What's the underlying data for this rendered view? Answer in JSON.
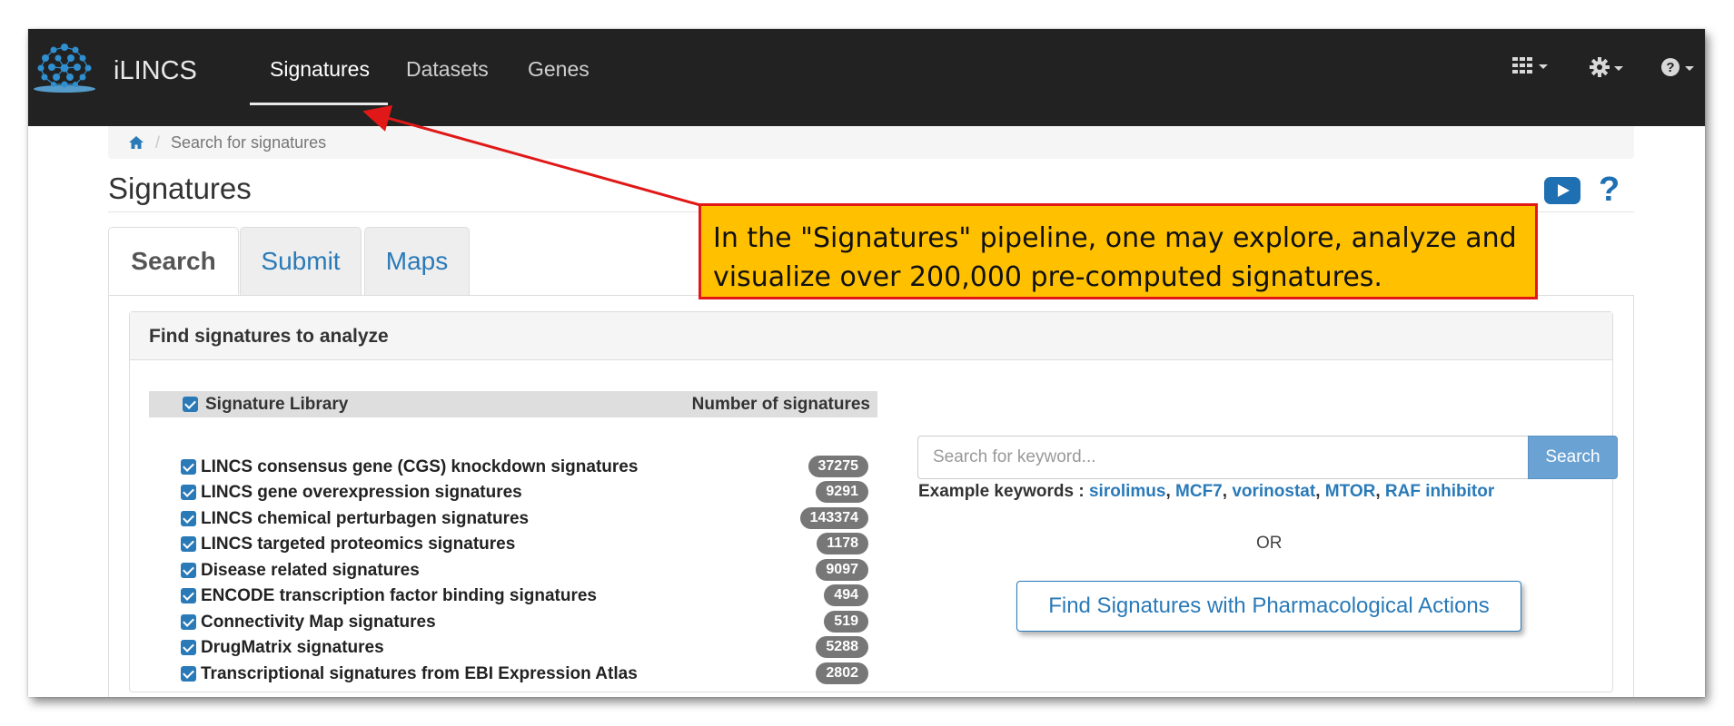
{
  "navbar": {
    "brand": "iLINCS",
    "items": [
      {
        "label": "Signatures",
        "active": true
      },
      {
        "label": "Datasets",
        "active": false
      },
      {
        "label": "Genes",
        "active": false
      }
    ],
    "right_icons": [
      "grid-icon",
      "gear-icon",
      "question-circle-icon"
    ]
  },
  "breadcrumb": {
    "home_icon": "home-icon",
    "current": "Search for signatures"
  },
  "page": {
    "title": "Signatures",
    "tabs": [
      {
        "label": "Search",
        "active": true
      },
      {
        "label": "Submit",
        "active": false
      },
      {
        "label": "Maps",
        "active": false
      }
    ]
  },
  "panel": {
    "heading": "Find signatures to analyze",
    "library_header": {
      "label": "Signature Library",
      "count_label": "Number of signatures",
      "checked": true
    },
    "libraries": [
      {
        "label": "LINCS consensus gene (CGS) knockdown signatures",
        "count": "37275",
        "checked": true
      },
      {
        "label": "LINCS gene overexpression signatures",
        "count": "9291",
        "checked": true
      },
      {
        "label": "LINCS chemical perturbagen signatures",
        "count": "143374",
        "checked": true
      },
      {
        "label": "LINCS targeted proteomics signatures",
        "count": "1178",
        "checked": true
      },
      {
        "label": "Disease related signatures",
        "count": "9097",
        "checked": true
      },
      {
        "label": "ENCODE transcription factor binding signatures",
        "count": "494",
        "checked": true
      },
      {
        "label": "Connectivity Map signatures",
        "count": "519",
        "checked": true
      },
      {
        "label": "DrugMatrix signatures",
        "count": "5288",
        "checked": true
      },
      {
        "label": "Transcriptional signatures from EBI Expression Atlas",
        "count": "2802",
        "checked": true
      }
    ]
  },
  "search": {
    "placeholder": "Search for keyword...",
    "button": "Search",
    "examples_label": "Example keywords :",
    "examples": [
      "sirolimus",
      "MCF7",
      "vorinostat",
      "MTOR",
      "RAF inhibitor"
    ],
    "or_text": "OR",
    "pharm_button": "Find Signatures with Pharmacological Actions"
  },
  "callout": {
    "line1": "In the \"Signatures\" pipeline, one may explore, analyze and",
    "line2": "visualize over 200,000 pre-computed signatures."
  },
  "colors": {
    "navbar": "#222222",
    "link": "#2a7ab8",
    "callout_fill": "#ffc000",
    "callout_border": "#e01818",
    "badge": "#777777"
  }
}
